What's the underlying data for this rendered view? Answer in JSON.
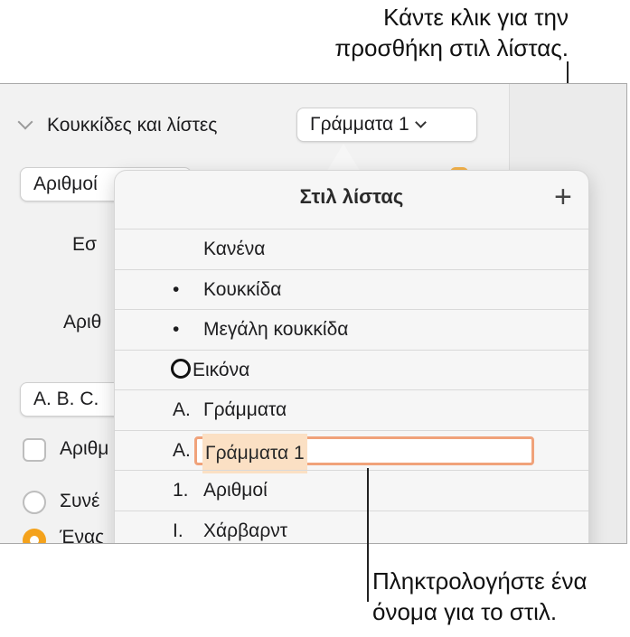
{
  "callouts": {
    "top_line1": "Κάντε κλικ για την",
    "top_line2": "προσθήκη στιλ λίστας.",
    "bottom_line1": "Πληκτρολογήστε ένα",
    "bottom_line2": "όνομα για το στιλ."
  },
  "panel": {
    "section_title": "Κουκκίδες και λίστες",
    "style_popup_value": "Γράμματα 1",
    "numbers_popup_partial": "Αριθμοί",
    "indent_label_partial": "Εσ",
    "number_label_partial": "Αριθ",
    "letters_popup_partial": "A. B. C.",
    "checkbox_label_partial": "Αριθμ",
    "radio1_label_partial": "Συνέ",
    "radio2_label_partial": "Ένας"
  },
  "popover": {
    "title": "Στιλ λίστας",
    "add_icon": "plus-icon",
    "items": [
      {
        "prefix": "",
        "label": "Κανένα"
      },
      {
        "prefix": "•",
        "label": "Κουκκίδα"
      },
      {
        "prefix": "•",
        "label": "Μεγάλη κουκκίδα"
      },
      {
        "prefix": "",
        "label": "Εικόνα"
      },
      {
        "prefix": "A.",
        "label": "Γράμματα"
      },
      {
        "prefix": "A.",
        "label": "Γράμματα 1"
      },
      {
        "prefix": "1.",
        "label": "Αριθμοί"
      },
      {
        "prefix": "I.",
        "label": "Χάρβαρντ"
      }
    ]
  },
  "colors": {
    "accent": "#f4a21c",
    "edit_border": "#f0a27a",
    "selection": "#fbe0c4"
  }
}
